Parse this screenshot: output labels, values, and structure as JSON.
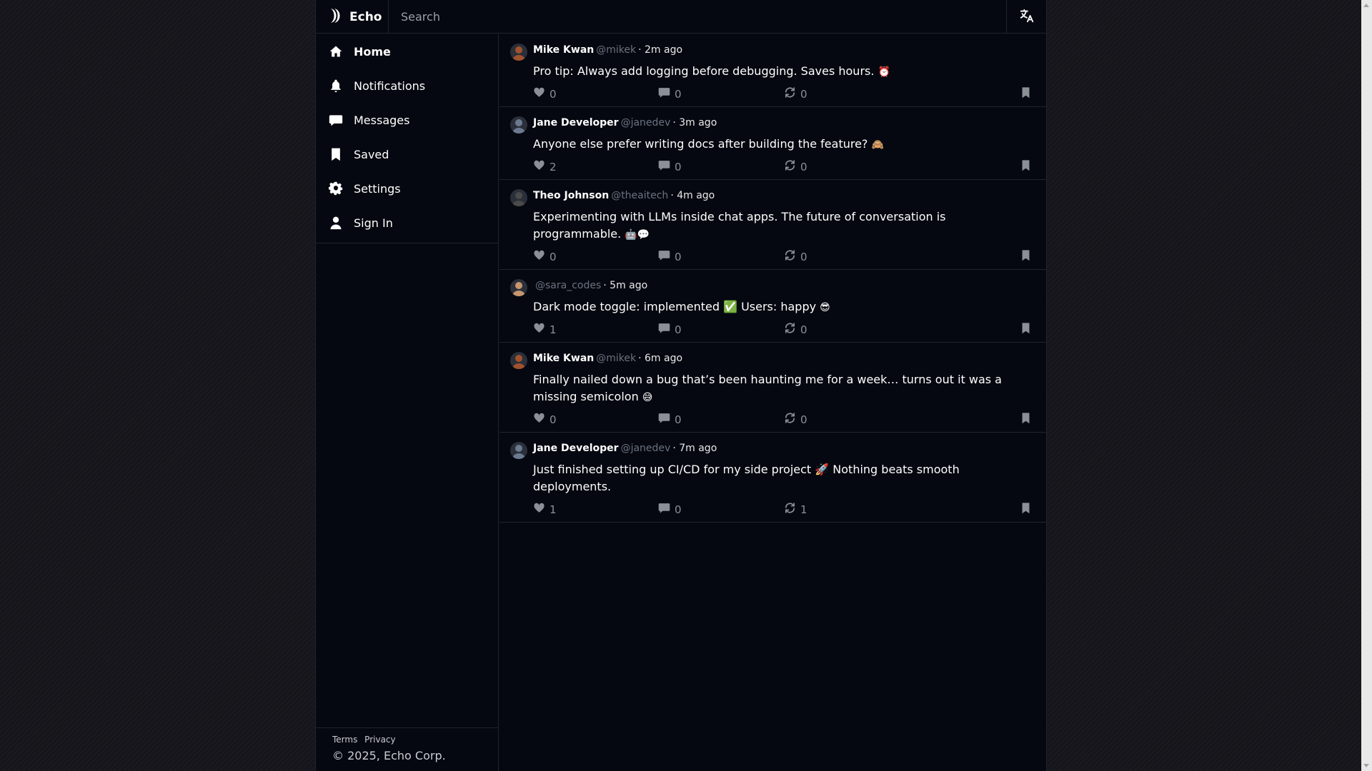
{
  "app": {
    "name": "Echo"
  },
  "search": {
    "placeholder": "Search"
  },
  "nav": [
    {
      "label": "Home",
      "icon": "home-icon",
      "active": true
    },
    {
      "label": "Notifications",
      "icon": "bell-icon"
    },
    {
      "label": "Messages",
      "icon": "chat-bubble-icon"
    },
    {
      "label": "Saved",
      "icon": "bookmark-icon"
    },
    {
      "label": "Settings",
      "icon": "gear-icon"
    },
    {
      "label": "Sign In",
      "icon": "user-icon"
    }
  ],
  "footer": {
    "links": [
      "Terms",
      "Privacy"
    ],
    "copyright": "© 2025, Echo Corp."
  },
  "posts": [
    {
      "author": "Mike Kwan",
      "handle": "@mikek",
      "time": "2m ago",
      "text": "Pro tip: Always add logging before debugging. Saves hours.",
      "emoji": "⏰",
      "likes": "0",
      "comments": "0",
      "reposts": "0",
      "avatar_color": "#a0522d"
    },
    {
      "author": "Jane Developer",
      "handle": "@janedev",
      "time": "3m ago",
      "text": "Anyone else prefer writing docs after building the feature?",
      "emoji": "🙈",
      "likes": "2",
      "comments": "0",
      "reposts": "0",
      "avatar_color": "#6b7a8f"
    },
    {
      "author": "Theo Johnson",
      "handle": "@theaitech",
      "time": "4m ago",
      "text": "Experimenting with LLMs inside chat apps. The future of conversation is programmable.",
      "emoji": "🤖💬",
      "likes": "0",
      "comments": "0",
      "reposts": "0",
      "avatar_color": "#4a4a4a"
    },
    {
      "author": "",
      "handle": "@sara_codes",
      "time": "5m ago",
      "text": "Dark mode toggle: implemented ✅ Users: happy",
      "emoji": "😎",
      "likes": "1",
      "comments": "0",
      "reposts": "0",
      "avatar_color": "#c8956d"
    },
    {
      "author": "Mike Kwan",
      "handle": "@mikek",
      "time": "6m ago",
      "text": "Finally nailed down a bug that’s been haunting me for a week… turns out it was a missing semicolon",
      "emoji": "😅",
      "likes": "0",
      "comments": "0",
      "reposts": "0",
      "avatar_color": "#a0522d"
    },
    {
      "author": "Jane Developer",
      "handle": "@janedev",
      "time": "7m ago",
      "text": "Just finished setting up CI/CD for my side project 🚀 Nothing beats smooth deployments.",
      "emoji": "",
      "likes": "1",
      "comments": "0",
      "reposts": "1",
      "avatar_color": "#6b7a8f"
    }
  ],
  "colors": {
    "background": "#050810",
    "border": "#1f2430",
    "muted": "#8b8f96"
  }
}
